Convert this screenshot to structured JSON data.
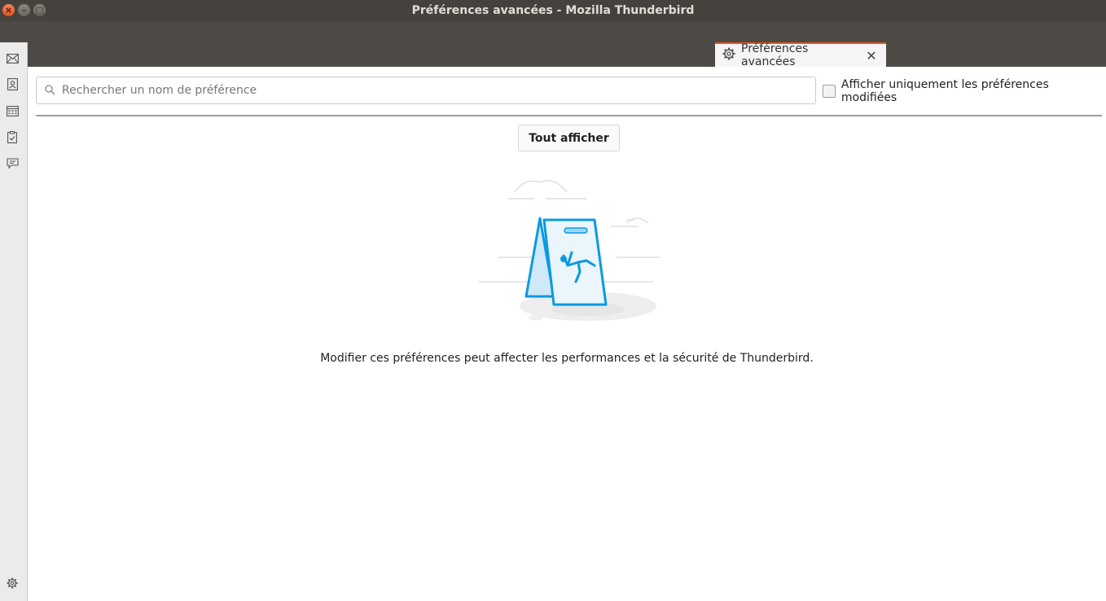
{
  "window": {
    "title": "Préférences avancées - Mozilla Thunderbird",
    "buttons": {
      "close": "×",
      "minimize": "–",
      "maximize": "□"
    }
  },
  "tab": {
    "label": "Préférences avancées",
    "icon": "gear-icon",
    "close_glyph": "✕",
    "accent_color": "#e95420"
  },
  "sidebar": {
    "items": [
      {
        "name": "mail",
        "icon": "envelope-icon"
      },
      {
        "name": "address-book",
        "icon": "address-book-icon"
      },
      {
        "name": "calendar",
        "icon": "calendar-icon"
      },
      {
        "name": "tasks",
        "icon": "tasks-icon"
      },
      {
        "name": "chat",
        "icon": "chat-icon"
      }
    ],
    "footer_icon": "gear-icon"
  },
  "search": {
    "placeholder": "Rechercher un nom de préférence",
    "value": "",
    "icon": "search-icon"
  },
  "filter": {
    "label": "Afficher uniquement les préférences modifiées",
    "checked": false
  },
  "show_all_button": "Tout afficher",
  "warning_text": "Modifier ces préférences peut affecter les performances et la sécurité de Thunderbird.",
  "illustration": {
    "name": "caution-sign-illustration",
    "accent_color": "#0a9ae0"
  }
}
